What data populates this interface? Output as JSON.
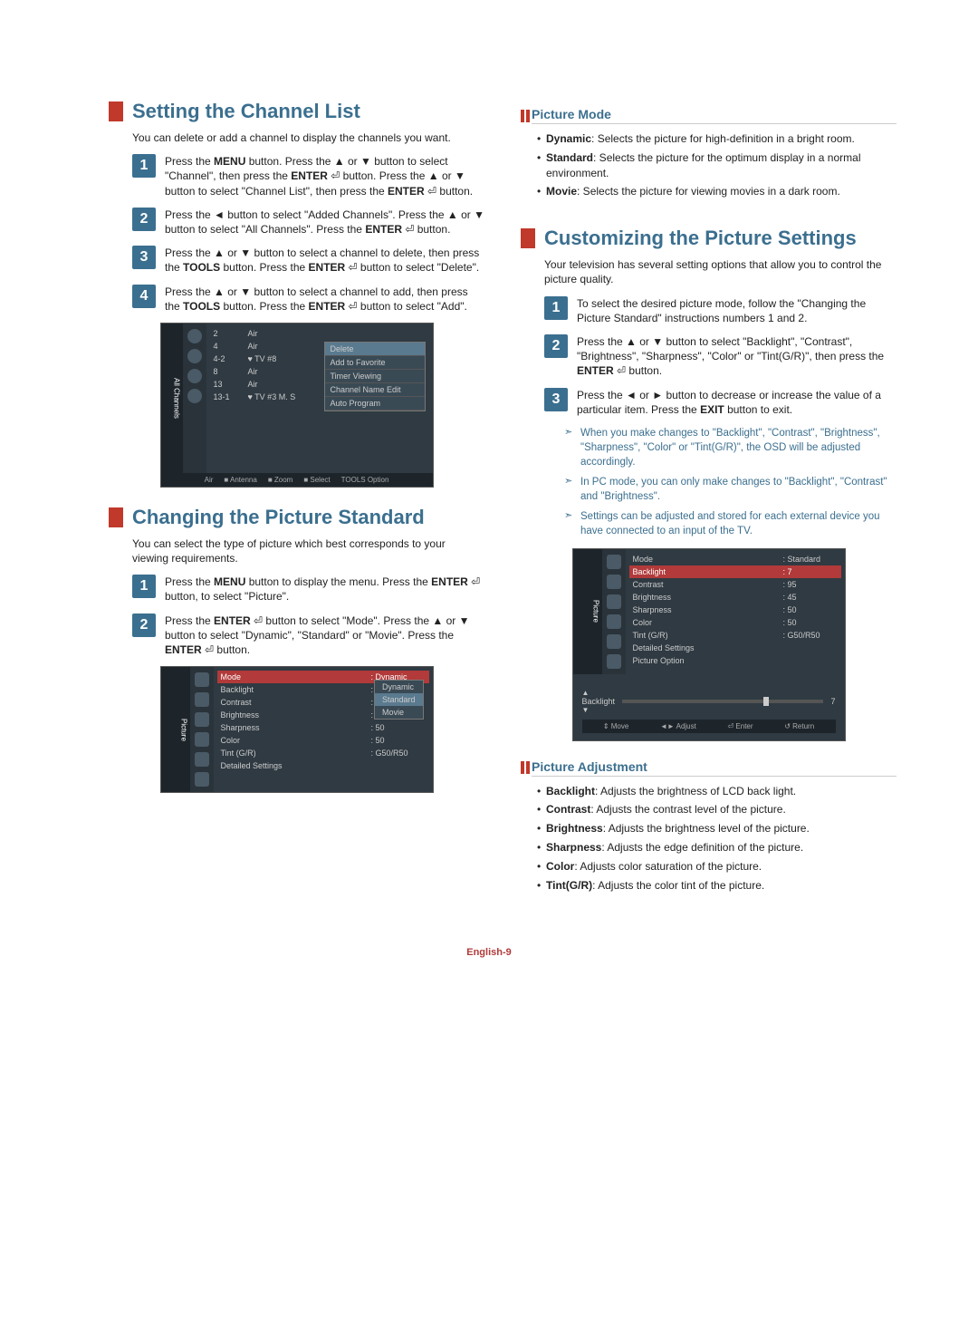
{
  "left": {
    "sec1": {
      "title": "Setting the Channel List",
      "intro": "You can delete or add a channel to display the channels you want.",
      "steps": [
        "Press the MENU button. Press the ▲ or ▼ button to select \"Channel\", then press the ENTER ⏎ button. Press the ▲ or ▼ button to select \"Channel List\", then press the ENTER ⏎ button.",
        "Press the ◄ button to select \"Added Channels\". Press the ▲ or ▼ button to select \"All Channels\". Press the ENTER ⏎ button.",
        "Press the ▲ or ▼ button to select a channel to delete, then press the TOOLS button. Press the ENTER ⏎ button to select \"Delete\".",
        "Press the ▲ or ▼ button to select a channel to add, then press the TOOLS button. Press the ENTER ⏎ button to select \"Add\"."
      ],
      "osd": {
        "sideLabel": "All Channels",
        "rows": [
          {
            "num": "2",
            "name": "Air"
          },
          {
            "num": "4",
            "name": "Air"
          },
          {
            "num": "4-2",
            "name": "♥ TV #8"
          },
          {
            "num": "8",
            "name": "Air"
          },
          {
            "num": "13",
            "name": "Air"
          },
          {
            "num": "13-1",
            "name": "♥ TV #3   M. S"
          }
        ],
        "menu": [
          "Delete",
          "Add to Favorite",
          "Timer Viewing",
          "Channel Name Edit",
          "Auto Program"
        ],
        "footer": [
          "Air",
          "■ Antenna",
          "■ Zoom",
          "■ Select",
          "TOOLS Option"
        ]
      }
    },
    "sec2": {
      "title": "Changing the Picture Standard",
      "intro": "You can select the type of picture which best corresponds to your viewing requirements.",
      "steps": [
        "Press the MENU button to display the menu. Press the ENTER ⏎ button, to select \"Picture\".",
        "Press the ENTER ⏎ button to select \"Mode\". Press the ▲ or ▼ button to select \"Dynamic\", \"Standard\" or \"Movie\". Press the ENTER ⏎ button."
      ],
      "osd": {
        "sideLabel": "Picture",
        "rows": [
          {
            "k": "Mode",
            "v": ": Dynamic",
            "sel": true
          },
          {
            "k": "Backlight",
            "v": ": 7"
          },
          {
            "k": "Contrast",
            "v": ": 95"
          },
          {
            "k": "Brightness",
            "v": ": 45"
          },
          {
            "k": "Sharpness",
            "v": ": 50"
          },
          {
            "k": "Color",
            "v": ": 50"
          },
          {
            "k": "Tint (G/R)",
            "v": ": G50/R50"
          },
          {
            "k": "Detailed Settings",
            "v": ""
          }
        ],
        "drop": [
          "Dynamic",
          "Standard",
          "Movie"
        ]
      }
    }
  },
  "right": {
    "sub1": {
      "title": "Picture Mode",
      "bullets": [
        {
          "b": "Dynamic",
          "t": ": Selects the picture for high-definition in a bright room."
        },
        {
          "b": "Standard",
          "t": ": Selects the picture for the optimum display in a normal environment."
        },
        {
          "b": "Movie",
          "t": ": Selects the picture for viewing movies in a dark room."
        }
      ]
    },
    "sec1": {
      "title": "Customizing the Picture Settings",
      "intro": "Your television has several setting options that allow you to control the picture quality.",
      "steps": [
        "To select the desired picture mode, follow the \"Changing the Picture Standard\" instructions numbers 1 and 2.",
        "Press the ▲ or ▼ button to select \"Backlight\", \"Contrast\", \"Brightness\", \"Sharpness\", \"Color\" or \"Tint(G/R)\", then press the ENTER ⏎ button.",
        "Press the ◄ or ► button to decrease or increase the value of a particular item. Press the EXIT button to exit."
      ],
      "notes": [
        "When you make changes to \"Backlight\", \"Contrast\", \"Brightness\", \"Sharpness\", \"Color\" or \"Tint(G/R)\", the OSD will be adjusted accordingly.",
        "In PC mode, you can only make changes to \"Backlight\", \"Contrast\" and \"Brightness\".",
        "Settings can be adjusted and stored for each external device you have connected to an input of the TV."
      ],
      "osd": {
        "sideLabel": "Picture",
        "rows": [
          {
            "k": "Mode",
            "v": ": Standard"
          },
          {
            "k": "Backlight",
            "v": ": 7",
            "sel": true
          },
          {
            "k": "Contrast",
            "v": ": 95"
          },
          {
            "k": "Brightness",
            "v": ": 45"
          },
          {
            "k": "Sharpness",
            "v": ": 50"
          },
          {
            "k": "Color",
            "v": ": 50"
          },
          {
            "k": "Tint (G/R)",
            "v": ": G50/R50"
          },
          {
            "k": "Detailed Settings",
            "v": ""
          },
          {
            "k": "Picture Option",
            "v": ""
          }
        ],
        "slider": {
          "label": "Backlight",
          "value": "7",
          "pos": 70
        },
        "footer": [
          "⇕ Move",
          "◄► Adjust",
          "⏎ Enter",
          "↺ Return"
        ]
      }
    },
    "sub2": {
      "title": "Picture Adjustment",
      "bullets": [
        {
          "b": "Backlight",
          "t": ": Adjusts the brightness of LCD back light."
        },
        {
          "b": "Contrast",
          "t": ": Adjusts the contrast level of the picture."
        },
        {
          "b": "Brightness",
          "t": ": Adjusts the brightness level of the picture."
        },
        {
          "b": "Sharpness",
          "t": ": Adjusts the edge definition of the picture."
        },
        {
          "b": "Color",
          "t": ": Adjusts color saturation of the picture."
        },
        {
          "b": "Tint(G/R)",
          "t": ": Adjusts the color tint of the picture."
        }
      ]
    }
  },
  "footer": "English-9"
}
